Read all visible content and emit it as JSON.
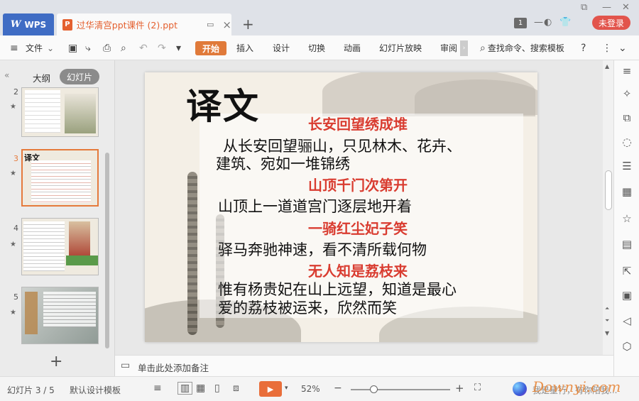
{
  "app": {
    "name": "WPS",
    "doc_tab_title": "过华清宫ppt课件 (2).ppt",
    "page_indicator": "1",
    "login_label": "未登录"
  },
  "ribbon": {
    "file_label": "文件",
    "tabs": [
      "开始",
      "插入",
      "设计",
      "切换",
      "动画",
      "幻灯片放映",
      "审阅"
    ],
    "search_label": "查找命令、搜索模板"
  },
  "left_panel": {
    "tab_outline": "大纲",
    "tab_slides": "幻灯片",
    "slides": [
      {
        "num": "2"
      },
      {
        "num": "3"
      },
      {
        "num": "4"
      },
      {
        "num": "5"
      }
    ]
  },
  "slide": {
    "title": "译文",
    "lines": [
      {
        "style": "red",
        "text": "长安回望绣成堆"
      },
      {
        "style": "blk",
        "text": "从长安回望骊山，只见林木、花卉、"
      },
      {
        "style": "blk",
        "text": "建筑、宛如一堆锦绣"
      },
      {
        "style": "red",
        "text": "山顶千门次第开"
      },
      {
        "style": "blk",
        "text": "山顶上一道道宫门逐层地开着"
      },
      {
        "style": "red",
        "text": "一骑红尘妃子笑"
      },
      {
        "style": "blk",
        "text": "驿马奔驰神速，看不清所载何物"
      },
      {
        "style": "red",
        "text": "无人知是荔枝来"
      },
      {
        "style": "blk",
        "text": "惟有杨贵妃在山上远望，知道是最心"
      },
      {
        "style": "blk",
        "text": "爱的荔枝被运来，欣然而笑"
      }
    ]
  },
  "notes": {
    "placeholder": "单击此处添加备注"
  },
  "status": {
    "slide_count": "幻灯片 3 / 5",
    "template": "默认设计模板",
    "zoom": "52%",
    "assistant_text": "我是星行，有你陪我...",
    "watermark": "Downyi.com"
  },
  "colors": {
    "accent": "#e07a3a",
    "wps_blue": "#3f6cc4",
    "login_red": "#e2544c",
    "title_red": "#d93c30"
  }
}
